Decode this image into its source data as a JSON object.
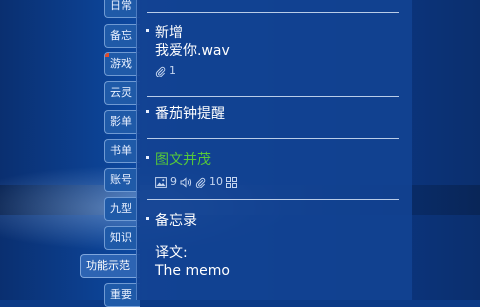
{
  "colors": {
    "panel": "#12428f",
    "tab": "#1f5aa8",
    "active_tab": "#2d64b3",
    "green_title": "#55c83a",
    "flag": "#e04a2a"
  },
  "sidebar": {
    "tabs": [
      {
        "label": "日常",
        "icon": "none"
      },
      {
        "label": "备忘",
        "icon": "none"
      },
      {
        "label": "游戏",
        "icon": "red-flag-icon"
      },
      {
        "label": "云灵",
        "icon": "none"
      },
      {
        "label": "影单",
        "icon": "none"
      },
      {
        "label": "书单",
        "icon": "none"
      },
      {
        "label": "账号",
        "icon": "none"
      },
      {
        "label": "九型",
        "icon": "none"
      },
      {
        "label": "知识",
        "icon": "none"
      },
      {
        "label": "重要",
        "icon": "none"
      }
    ],
    "active_tab_label": "功能示范"
  },
  "notes": [
    {
      "title": "新增",
      "body": "我爱你.wav",
      "attachment_icon": "paperclip-icon",
      "attachment_count": "1"
    },
    {
      "title": "番茄钟提醒"
    },
    {
      "title": "图文并茂",
      "title_color": "#55c83a",
      "image_icon": "image-icon",
      "image_count": "9",
      "audio_icon": "speaker-icon",
      "attachment_icon": "paperclip-icon",
      "attachment_count": "10",
      "grid_icon": "grid-icon"
    },
    {
      "title": "备忘录",
      "body_line1": "译文:",
      "body_line2": "The memo"
    }
  ]
}
